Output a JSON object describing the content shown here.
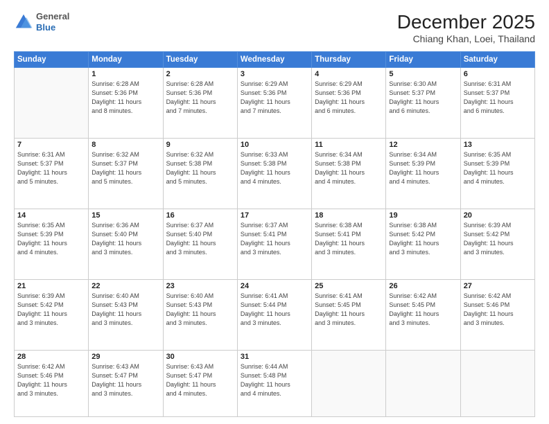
{
  "header": {
    "logo_general": "General",
    "logo_blue": "Blue",
    "month_title": "December 2025",
    "location": "Chiang Khan, Loei, Thailand"
  },
  "weekdays": [
    "Sunday",
    "Monday",
    "Tuesday",
    "Wednesday",
    "Thursday",
    "Friday",
    "Saturday"
  ],
  "weeks": [
    [
      {
        "day": "",
        "info": ""
      },
      {
        "day": "1",
        "info": "Sunrise: 6:28 AM\nSunset: 5:36 PM\nDaylight: 11 hours\nand 8 minutes."
      },
      {
        "day": "2",
        "info": "Sunrise: 6:28 AM\nSunset: 5:36 PM\nDaylight: 11 hours\nand 7 minutes."
      },
      {
        "day": "3",
        "info": "Sunrise: 6:29 AM\nSunset: 5:36 PM\nDaylight: 11 hours\nand 7 minutes."
      },
      {
        "day": "4",
        "info": "Sunrise: 6:29 AM\nSunset: 5:36 PM\nDaylight: 11 hours\nand 6 minutes."
      },
      {
        "day": "5",
        "info": "Sunrise: 6:30 AM\nSunset: 5:37 PM\nDaylight: 11 hours\nand 6 minutes."
      },
      {
        "day": "6",
        "info": "Sunrise: 6:31 AM\nSunset: 5:37 PM\nDaylight: 11 hours\nand 6 minutes."
      }
    ],
    [
      {
        "day": "7",
        "info": "Sunrise: 6:31 AM\nSunset: 5:37 PM\nDaylight: 11 hours\nand 5 minutes."
      },
      {
        "day": "8",
        "info": "Sunrise: 6:32 AM\nSunset: 5:37 PM\nDaylight: 11 hours\nand 5 minutes."
      },
      {
        "day": "9",
        "info": "Sunrise: 6:32 AM\nSunset: 5:38 PM\nDaylight: 11 hours\nand 5 minutes."
      },
      {
        "day": "10",
        "info": "Sunrise: 6:33 AM\nSunset: 5:38 PM\nDaylight: 11 hours\nand 4 minutes."
      },
      {
        "day": "11",
        "info": "Sunrise: 6:34 AM\nSunset: 5:38 PM\nDaylight: 11 hours\nand 4 minutes."
      },
      {
        "day": "12",
        "info": "Sunrise: 6:34 AM\nSunset: 5:39 PM\nDaylight: 11 hours\nand 4 minutes."
      },
      {
        "day": "13",
        "info": "Sunrise: 6:35 AM\nSunset: 5:39 PM\nDaylight: 11 hours\nand 4 minutes."
      }
    ],
    [
      {
        "day": "14",
        "info": "Sunrise: 6:35 AM\nSunset: 5:39 PM\nDaylight: 11 hours\nand 4 minutes."
      },
      {
        "day": "15",
        "info": "Sunrise: 6:36 AM\nSunset: 5:40 PM\nDaylight: 11 hours\nand 3 minutes."
      },
      {
        "day": "16",
        "info": "Sunrise: 6:37 AM\nSunset: 5:40 PM\nDaylight: 11 hours\nand 3 minutes."
      },
      {
        "day": "17",
        "info": "Sunrise: 6:37 AM\nSunset: 5:41 PM\nDaylight: 11 hours\nand 3 minutes."
      },
      {
        "day": "18",
        "info": "Sunrise: 6:38 AM\nSunset: 5:41 PM\nDaylight: 11 hours\nand 3 minutes."
      },
      {
        "day": "19",
        "info": "Sunrise: 6:38 AM\nSunset: 5:42 PM\nDaylight: 11 hours\nand 3 minutes."
      },
      {
        "day": "20",
        "info": "Sunrise: 6:39 AM\nSunset: 5:42 PM\nDaylight: 11 hours\nand 3 minutes."
      }
    ],
    [
      {
        "day": "21",
        "info": "Sunrise: 6:39 AM\nSunset: 5:42 PM\nDaylight: 11 hours\nand 3 minutes."
      },
      {
        "day": "22",
        "info": "Sunrise: 6:40 AM\nSunset: 5:43 PM\nDaylight: 11 hours\nand 3 minutes."
      },
      {
        "day": "23",
        "info": "Sunrise: 6:40 AM\nSunset: 5:43 PM\nDaylight: 11 hours\nand 3 minutes."
      },
      {
        "day": "24",
        "info": "Sunrise: 6:41 AM\nSunset: 5:44 PM\nDaylight: 11 hours\nand 3 minutes."
      },
      {
        "day": "25",
        "info": "Sunrise: 6:41 AM\nSunset: 5:45 PM\nDaylight: 11 hours\nand 3 minutes."
      },
      {
        "day": "26",
        "info": "Sunrise: 6:42 AM\nSunset: 5:45 PM\nDaylight: 11 hours\nand 3 minutes."
      },
      {
        "day": "27",
        "info": "Sunrise: 6:42 AM\nSunset: 5:46 PM\nDaylight: 11 hours\nand 3 minutes."
      }
    ],
    [
      {
        "day": "28",
        "info": "Sunrise: 6:42 AM\nSunset: 5:46 PM\nDaylight: 11 hours\nand 3 minutes."
      },
      {
        "day": "29",
        "info": "Sunrise: 6:43 AM\nSunset: 5:47 PM\nDaylight: 11 hours\nand 3 minutes."
      },
      {
        "day": "30",
        "info": "Sunrise: 6:43 AM\nSunset: 5:47 PM\nDaylight: 11 hours\nand 4 minutes."
      },
      {
        "day": "31",
        "info": "Sunrise: 6:44 AM\nSunset: 5:48 PM\nDaylight: 11 hours\nand 4 minutes."
      },
      {
        "day": "",
        "info": ""
      },
      {
        "day": "",
        "info": ""
      },
      {
        "day": "",
        "info": ""
      }
    ]
  ]
}
